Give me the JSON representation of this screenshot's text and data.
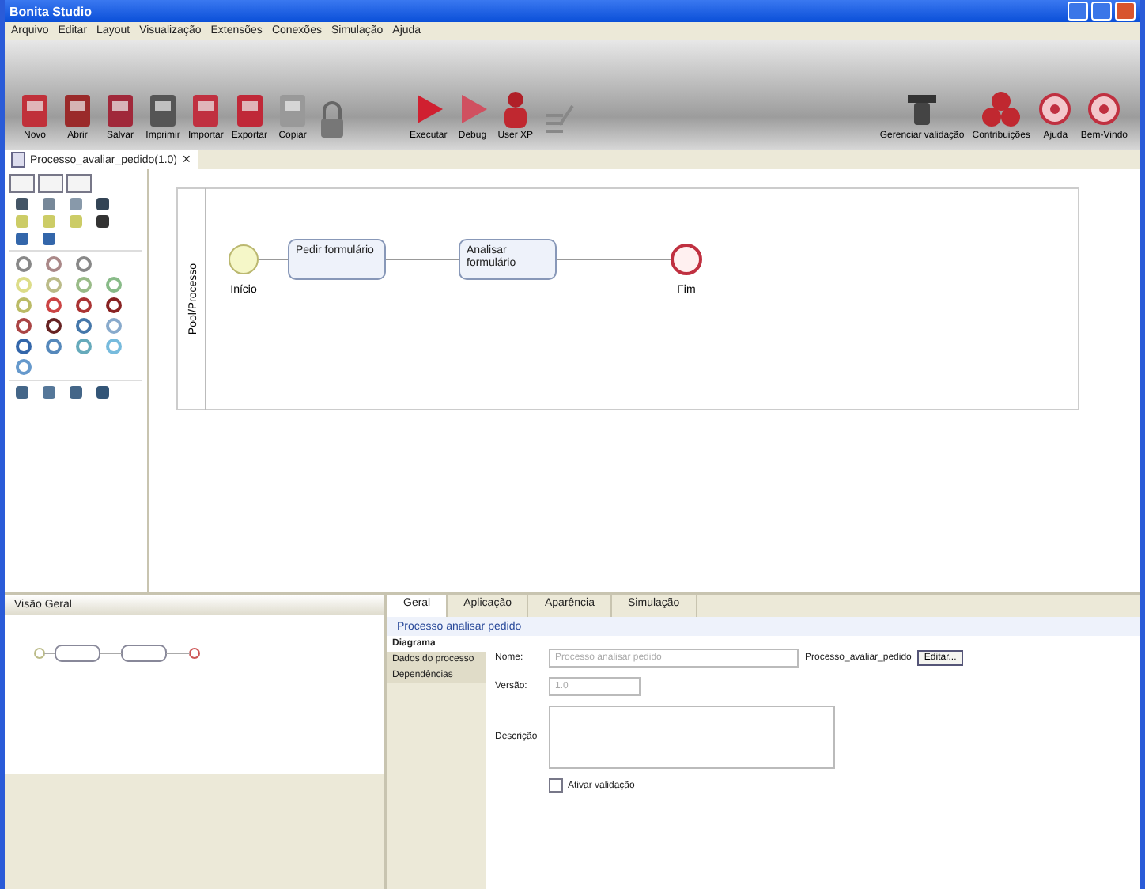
{
  "window": {
    "title": "Bonita Studio"
  },
  "menu": [
    "Arquivo",
    "Editar",
    "Layout",
    "Visualização",
    "Extensões",
    "Conexões",
    "Simulação",
    "Ajuda"
  ],
  "toolbar_left": [
    "Novo",
    "Abrir",
    "Salvar",
    "Imprimir",
    "Importar",
    "Exportar",
    "Copiar"
  ],
  "toolbar_center": [
    "Executar",
    "Debug",
    "User XP"
  ],
  "toolbar_right": [
    "Gerenciar validação",
    "Contribuições",
    "Ajuda",
    "Bem-Vindo"
  ],
  "editor_tab": {
    "label": "Processo_avaliar_pedido(1.0)",
    "close": "✕"
  },
  "diagram": {
    "lane": "Pool/Processo",
    "nodes": [
      {
        "kind": "start",
        "label": "Início"
      },
      {
        "kind": "task",
        "label": "Pedir formulário"
      },
      {
        "kind": "task",
        "label": "Analisar formulário"
      },
      {
        "kind": "end",
        "label": "Fim"
      }
    ]
  },
  "outline": {
    "title": "Visão Geral"
  },
  "properties": {
    "tabs": [
      {
        "label": "Geral",
        "selected": true
      },
      {
        "label": "Aplicação",
        "selected": false
      },
      {
        "label": "Aparência",
        "selected": false
      },
      {
        "label": "Simulação",
        "selected": false
      }
    ],
    "header": "Processo analisar pedido",
    "sections": [
      {
        "label": "Diagrama",
        "selected": true
      },
      {
        "label": "Dados do processo",
        "selected": false
      },
      {
        "label": "Dependências",
        "selected": false
      }
    ],
    "name_label": "Nome:",
    "name_value": "Processo analisar pedido",
    "file_name": "Processo_avaliar_pedido",
    "edit_button": "Editar...",
    "version_label": "Versão:",
    "version_value": "1.0",
    "description_label": "Descrição",
    "validation": {
      "label": "Ativar validação",
      "checked": false
    }
  }
}
